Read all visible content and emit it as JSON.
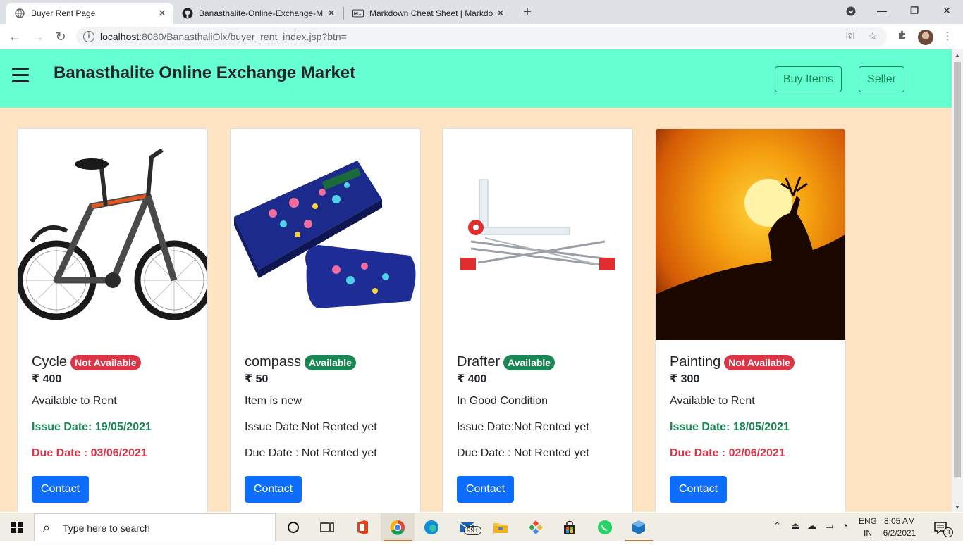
{
  "browser": {
    "tabs": [
      {
        "title": "Buyer Rent Page",
        "icon": "globe-icon"
      },
      {
        "title": "Banasthalite-Online-Exchange-M",
        "icon": "github-icon"
      },
      {
        "title": "Markdown Cheat Sheet | Markdo",
        "icon": "markdown-icon"
      }
    ],
    "url_host": "localhost",
    "url_rest": ":8080/BanasthaliOlx/buyer_rent_index.jsp?btn="
  },
  "navbar": {
    "brand": "Banasthalite Online Exchange Market",
    "buy_label": "Buy Items",
    "seller_label": "Seller"
  },
  "cards": [
    {
      "name": "Cycle",
      "badge": "Not Available",
      "price": "₹ 400",
      "desc": "Available to Rent",
      "issue": "Issue Date: 19/05/2021",
      "due": "Due Date : 03/06/2021",
      "contact": "Contact",
      "image": "bicycle"
    },
    {
      "name": "compass",
      "badge": "Available",
      "price": "₹ 50",
      "desc": "Item is new",
      "issue": "Issue Date:Not Rented yet",
      "due": "Due Date : Not Rented yet",
      "contact": "Contact",
      "image": "compass-box"
    },
    {
      "name": "Drafter",
      "badge": "Available",
      "price": "₹ 400",
      "desc": "In Good Condition",
      "issue": "Issue Date:Not Rented yet",
      "due": "Due Date : Not Rented yet",
      "contact": "Contact",
      "image": "drafter"
    },
    {
      "name": "Painting",
      "badge": "Not Available",
      "price": "₹ 300",
      "desc": "Available to Rent",
      "issue": "Issue Date: 18/05/2021",
      "due": "Due Date : 02/06/2021",
      "contact": "Contact",
      "image": "deer-sunset"
    }
  ],
  "taskbar": {
    "search_placeholder": "Type here to search",
    "mail_badge": "99+",
    "lang_top": "ENG",
    "lang_bottom": "IN",
    "time": "8:05 AM",
    "date": "6/2/2021",
    "notif_count": "3"
  },
  "colors": {
    "navbar_bg": "#66ffd1",
    "page_bg": "#ffe4c4",
    "available": "#198754",
    "not_available": "#dc3545",
    "primary": "#0d6efd"
  }
}
